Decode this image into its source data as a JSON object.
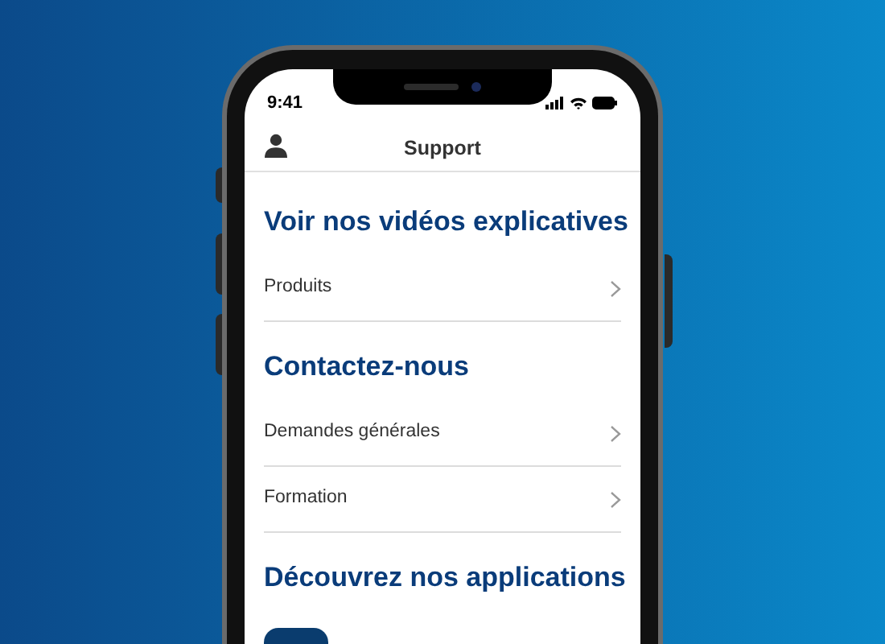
{
  "status_bar": {
    "time": "9:41"
  },
  "header": {
    "title": "Support"
  },
  "sections": [
    {
      "heading": "Voir nos vidéos explicatives",
      "rows": [
        {
          "label": "Produits"
        }
      ]
    },
    {
      "heading": "Contactez-nous",
      "rows": [
        {
          "label": "Demandes générales"
        },
        {
          "label": "Formation"
        }
      ]
    },
    {
      "heading": "Découvrez nos applications"
    }
  ]
}
